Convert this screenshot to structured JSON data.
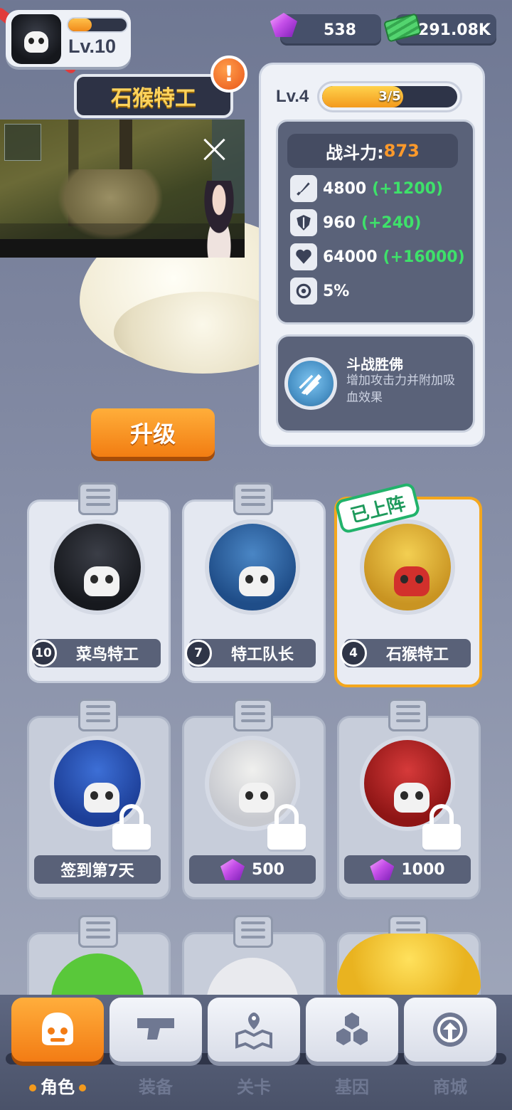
{
  "player": {
    "level": "Lv.10",
    "xp_fraction": 0.4
  },
  "currency": {
    "gems": "538",
    "cash": "291.08K"
  },
  "hero": {
    "name": "石猴特工",
    "alert": "!"
  },
  "stats": {
    "level": "Lv.4",
    "progress": "3/5",
    "progress_fraction": 0.6,
    "power_label": "战斗力:",
    "power_value": "873",
    "attack": "4800",
    "attack_bonus": "(+1200)",
    "defense": "960",
    "defense_bonus": "(+240)",
    "hp": "64000",
    "hp_bonus": "(+16000)",
    "crit": "5%"
  },
  "skill": {
    "name": "斗战胜佛",
    "desc": "增加攻击力并附加吸血效果"
  },
  "upgrade_label": "升级",
  "deployed_label": "已上阵",
  "cards": [
    {
      "level": "10",
      "name": "菜鸟特工"
    },
    {
      "level": "7",
      "name": "特工队长"
    },
    {
      "level": "4",
      "name": "石猴特工"
    },
    {
      "label": "签到第7天"
    },
    {
      "cost": "500"
    },
    {
      "cost": "1000"
    }
  ],
  "nav": [
    {
      "label": "角色",
      "icon": "character-icon",
      "active": true
    },
    {
      "label": "装备",
      "icon": "equipment-icon"
    },
    {
      "label": "关卡",
      "icon": "map-icon"
    },
    {
      "label": "基因",
      "icon": "gene-icon"
    },
    {
      "label": "商城",
      "icon": "shop-icon"
    }
  ],
  "colors": {
    "accent": "#f39a1d",
    "bonus": "#3ee16a",
    "power": "#ff9a2b",
    "deployed": "#22b36b"
  }
}
